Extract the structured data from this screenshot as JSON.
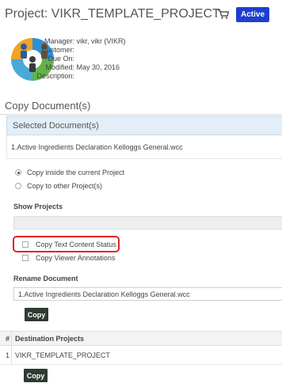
{
  "header": {
    "label": "Project:",
    "project_name": "VIKR_TEMPLATE_PROJECT",
    "status_badge": "Active",
    "badge_color": "#1e3ecf",
    "cart_icon": "shopping-cart-icon"
  },
  "meta": {
    "manager_label": "Manager:",
    "manager_value": "vikr, vikr (VIKR)",
    "customer_label": "Customer:",
    "customer_value": "",
    "due_label": "Due On:",
    "due_value": "",
    "modified_label": "Modified:",
    "modified_value": "May 30, 2016",
    "description_label": "Description:",
    "description_value": ""
  },
  "copy_section": {
    "title": "Copy Document(s)",
    "selected_header": "Selected Document(s)",
    "selected_doc": "1.Active Ingredients Declaration Kelloggs General.wcc",
    "options": [
      {
        "label": "Copy inside the current Project",
        "checked": true
      },
      {
        "label": "Copy to other Project(s)",
        "checked": false
      }
    ],
    "show_projects_label": "Show Projects",
    "show_projects_value": "",
    "copy_text_status_label": "Copy Text Content Status",
    "copy_viewer_annotations_label": "Copy Viewer Annotations",
    "rename_label": "Rename Document",
    "rename_value": "1.Active Ingredients Declaration Kelloggs General.wcc",
    "copy_button": "Copy"
  },
  "destination": {
    "num_header": "#",
    "name_header": "Destination Projects",
    "rows": [
      {
        "num": "1",
        "name": "VIKR_TEMPLATE_PROJECT"
      }
    ],
    "copy_button": "Copy"
  },
  "colors": {
    "highlight": "#e02424",
    "button_bg": "#2f3a32",
    "selected_header_bg": "#e3eef7"
  }
}
